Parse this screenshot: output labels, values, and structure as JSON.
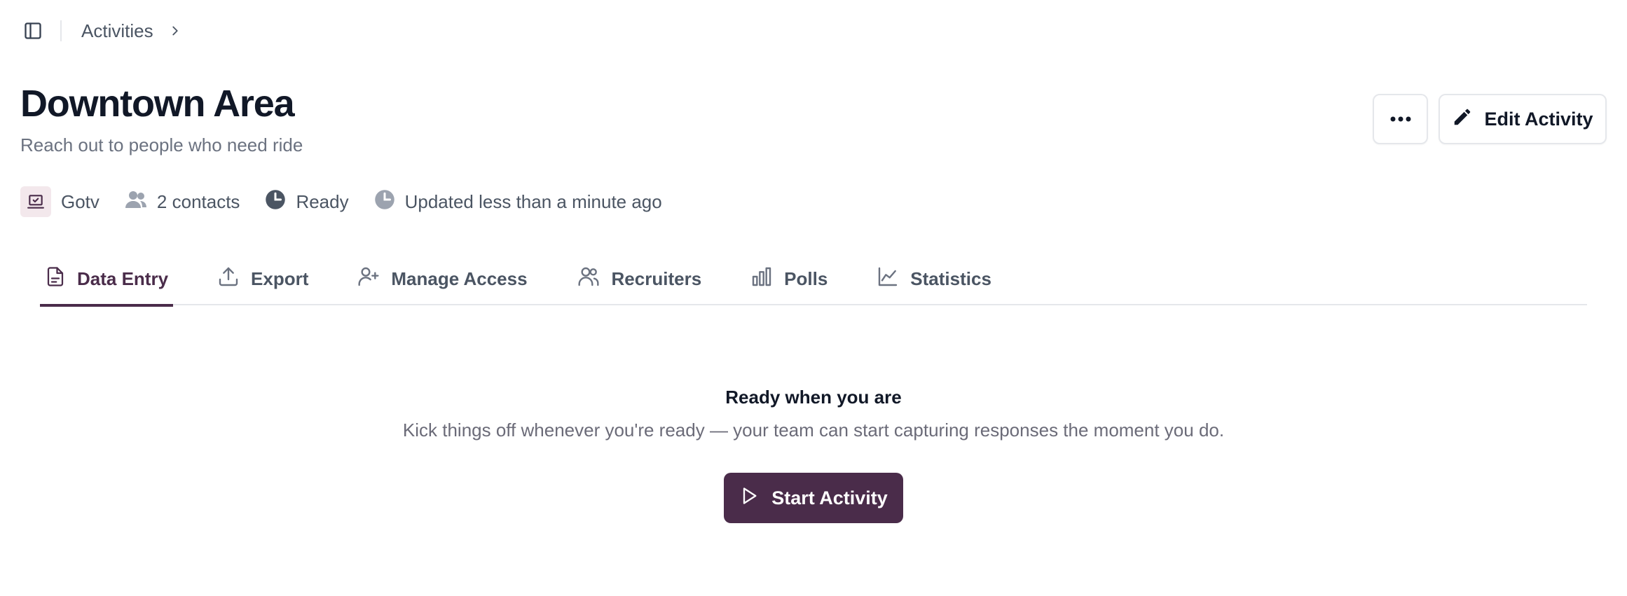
{
  "breadcrumb": {
    "items": [
      "Activities"
    ]
  },
  "page": {
    "title": "Downtown Area",
    "subtitle": "Reach out to people who need ride"
  },
  "header_actions": {
    "more_icon": "ellipsis-icon",
    "edit_label": "Edit Activity",
    "edit_icon": "pencil-icon"
  },
  "meta": {
    "type": "Gotv",
    "contacts": "2 contacts",
    "status": "Ready",
    "updated": "Updated less than a minute ago"
  },
  "tabs": [
    {
      "label": "Data Entry",
      "icon": "document-icon",
      "active": true
    },
    {
      "label": "Export",
      "icon": "upload-icon",
      "active": false
    },
    {
      "label": "Manage Access",
      "icon": "user-plus-icon",
      "active": false
    },
    {
      "label": "Recruiters",
      "icon": "users-icon",
      "active": false
    },
    {
      "label": "Polls",
      "icon": "bar-chart-icon",
      "active": false
    },
    {
      "label": "Statistics",
      "icon": "line-chart-icon",
      "active": false
    }
  ],
  "empty_state": {
    "title": "Ready when you are",
    "description": "Kick things off whenever you're ready — your team can start capturing responses the moment you do.",
    "button_label": "Start Activity"
  },
  "colors": {
    "accent": "#4a2c4a",
    "badge_bg": "#f3e8ec",
    "muted_text": "#6b7280"
  }
}
